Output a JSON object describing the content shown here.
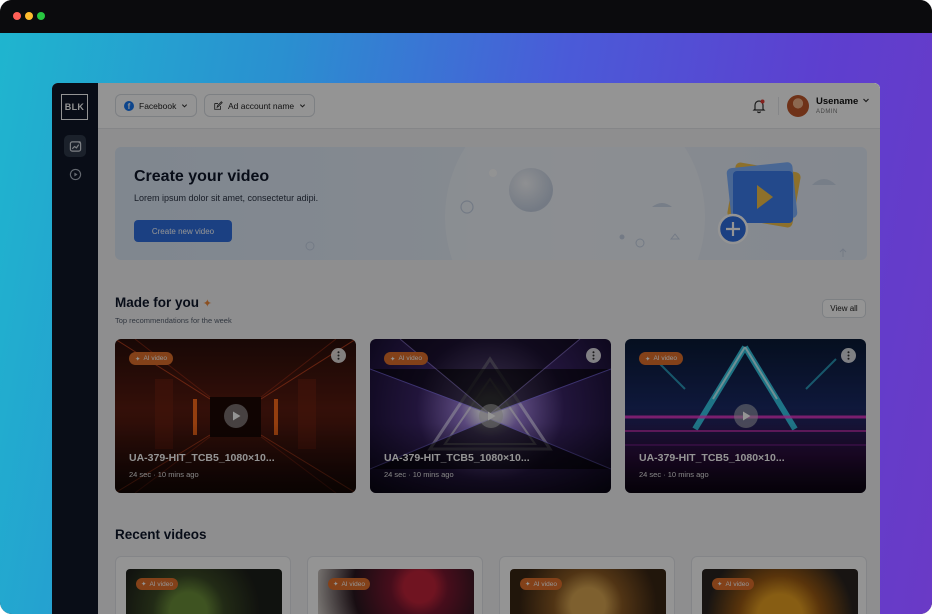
{
  "window": {
    "controls": [
      "close",
      "minimize",
      "maximize"
    ]
  },
  "sidebar": {
    "logo": "BLK",
    "items": [
      {
        "icon": "analytics-icon",
        "active": true
      },
      {
        "icon": "play-circle-icon",
        "active": false
      }
    ]
  },
  "topbar": {
    "platform_label": "Facebook",
    "ad_account_label": "Ad account name",
    "user_name": "Usename",
    "user_role": "ADMIN"
  },
  "hero": {
    "title": "Create your video",
    "subtitle": "Lorem ipsum dolor sit amet, consectetur adipi.",
    "button_label": "Create new video"
  },
  "made_for_you": {
    "title": "Made for you",
    "subtitle": "Top recommendations for the week",
    "view_all_label": "View all",
    "cards": [
      {
        "badge": "AI video",
        "title": "UA-379-HIT_TCB5_1080×10...",
        "meta": "24 sec · 10 mins ago"
      },
      {
        "badge": "AI video",
        "title": "UA-379-HIT_TCB5_1080×10...",
        "meta": "24 sec · 10 mins ago"
      },
      {
        "badge": "AI video",
        "title": "UA-379-HIT_TCB5_1080×10...",
        "meta": "24 sec · 10 mins ago"
      }
    ]
  },
  "recent_videos": {
    "title": "Recent videos",
    "cards": [
      {
        "badge": "AI video"
      },
      {
        "badge": "AI video"
      },
      {
        "badge": "AI video"
      },
      {
        "badge": "AI video"
      }
    ]
  },
  "colors": {
    "accent": "#2f6fe0",
    "badge": "#e2712b",
    "sidebar": "#101828",
    "sparkle": "#f08a3c"
  }
}
